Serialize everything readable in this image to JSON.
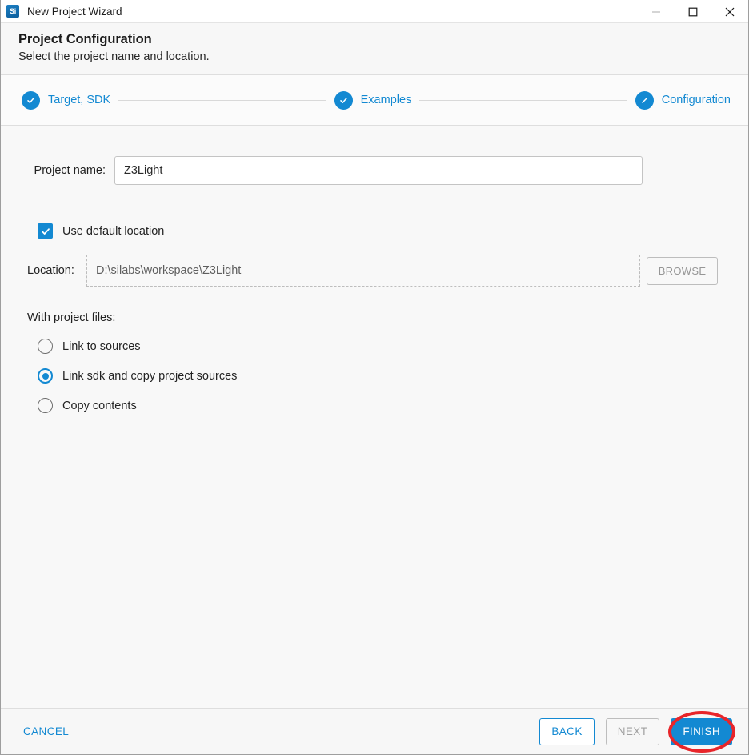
{
  "window": {
    "title": "New Project Wizard",
    "app_icon": "silabs-si-icon",
    "controls": {
      "minimize": "minimize-icon",
      "maximize": "maximize-icon",
      "close": "close-icon"
    }
  },
  "header": {
    "title": "Project Configuration",
    "subtitle": "Select the project name and location."
  },
  "stepper": {
    "steps": [
      {
        "label": "Target, SDK",
        "icon": "check-icon",
        "state": "complete"
      },
      {
        "label": "Examples",
        "icon": "check-icon",
        "state": "complete"
      },
      {
        "label": "Configuration",
        "icon": "pencil-icon",
        "state": "current"
      }
    ]
  },
  "form": {
    "project_name": {
      "label": "Project name:",
      "value": "Z3Light",
      "placeholder": ""
    },
    "use_default_location": {
      "label": "Use default location",
      "checked": true
    },
    "location": {
      "label": "Location:",
      "value": "D:\\silabs\\workspace\\Z3Light",
      "browse_label": "BROWSE",
      "browse_enabled": false
    },
    "project_files": {
      "label": "With project files:",
      "options": [
        {
          "label": "Link to sources",
          "selected": false
        },
        {
          "label": "Link sdk and copy project sources",
          "selected": true
        },
        {
          "label": "Copy contents",
          "selected": false
        }
      ]
    }
  },
  "footer": {
    "cancel_label": "CANCEL",
    "back_label": "BACK",
    "next_label": "NEXT",
    "finish_label": "FINISH",
    "next_enabled": false
  },
  "annotation": {
    "target": "finish-button",
    "shape": "ellipse",
    "color": "#e8252a"
  },
  "colors": {
    "accent": "#1389d2",
    "annotation": "#e8252a",
    "disabled_text": "#a0a0a0",
    "body_bg": "#f8f8f8"
  }
}
